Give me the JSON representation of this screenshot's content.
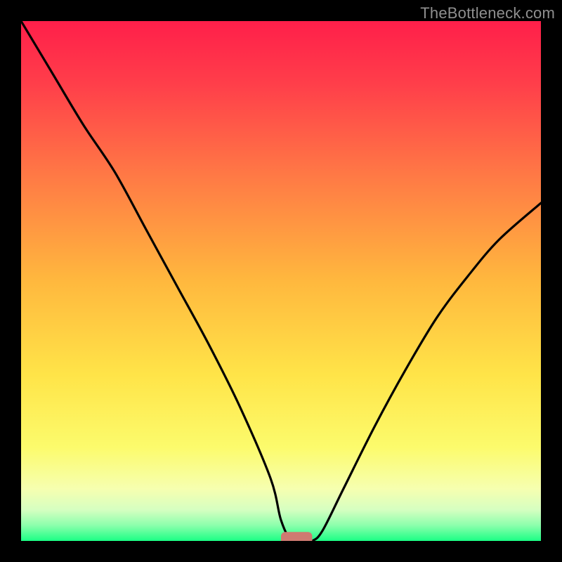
{
  "watermark": "TheBottleneck.com",
  "chart_data": {
    "type": "line",
    "title": "",
    "xlabel": "",
    "ylabel": "",
    "xlim": [
      0,
      100
    ],
    "ylim": [
      0,
      100
    ],
    "grid": false,
    "legend": false,
    "series": [
      {
        "name": "bottleneck-curve",
        "x": [
          0,
          6,
          12,
          18,
          24,
          30,
          36,
          42,
          48,
          50,
          52,
          54,
          56,
          58,
          62,
          68,
          74,
          80,
          86,
          92,
          100
        ],
        "y": [
          100,
          90,
          80,
          71,
          60,
          49,
          38,
          26,
          12,
          4,
          0,
          0,
          0,
          2,
          10,
          22,
          33,
          43,
          51,
          58,
          65
        ]
      }
    ],
    "marker": {
      "name": "optimal-zone",
      "x": 53,
      "y": 0,
      "width": 6,
      "height": 2,
      "color": "#cf7a71"
    },
    "gradient_stops": [
      {
        "offset": 0.0,
        "color": "#ff1f4a"
      },
      {
        "offset": 0.12,
        "color": "#ff3e4a"
      },
      {
        "offset": 0.3,
        "color": "#ff7a45"
      },
      {
        "offset": 0.5,
        "color": "#ffb83e"
      },
      {
        "offset": 0.68,
        "color": "#ffe448"
      },
      {
        "offset": 0.82,
        "color": "#fcfb6c"
      },
      {
        "offset": 0.9,
        "color": "#f6ffb0"
      },
      {
        "offset": 0.94,
        "color": "#d6ffc1"
      },
      {
        "offset": 0.97,
        "color": "#8cffac"
      },
      {
        "offset": 1.0,
        "color": "#1bff85"
      }
    ]
  }
}
